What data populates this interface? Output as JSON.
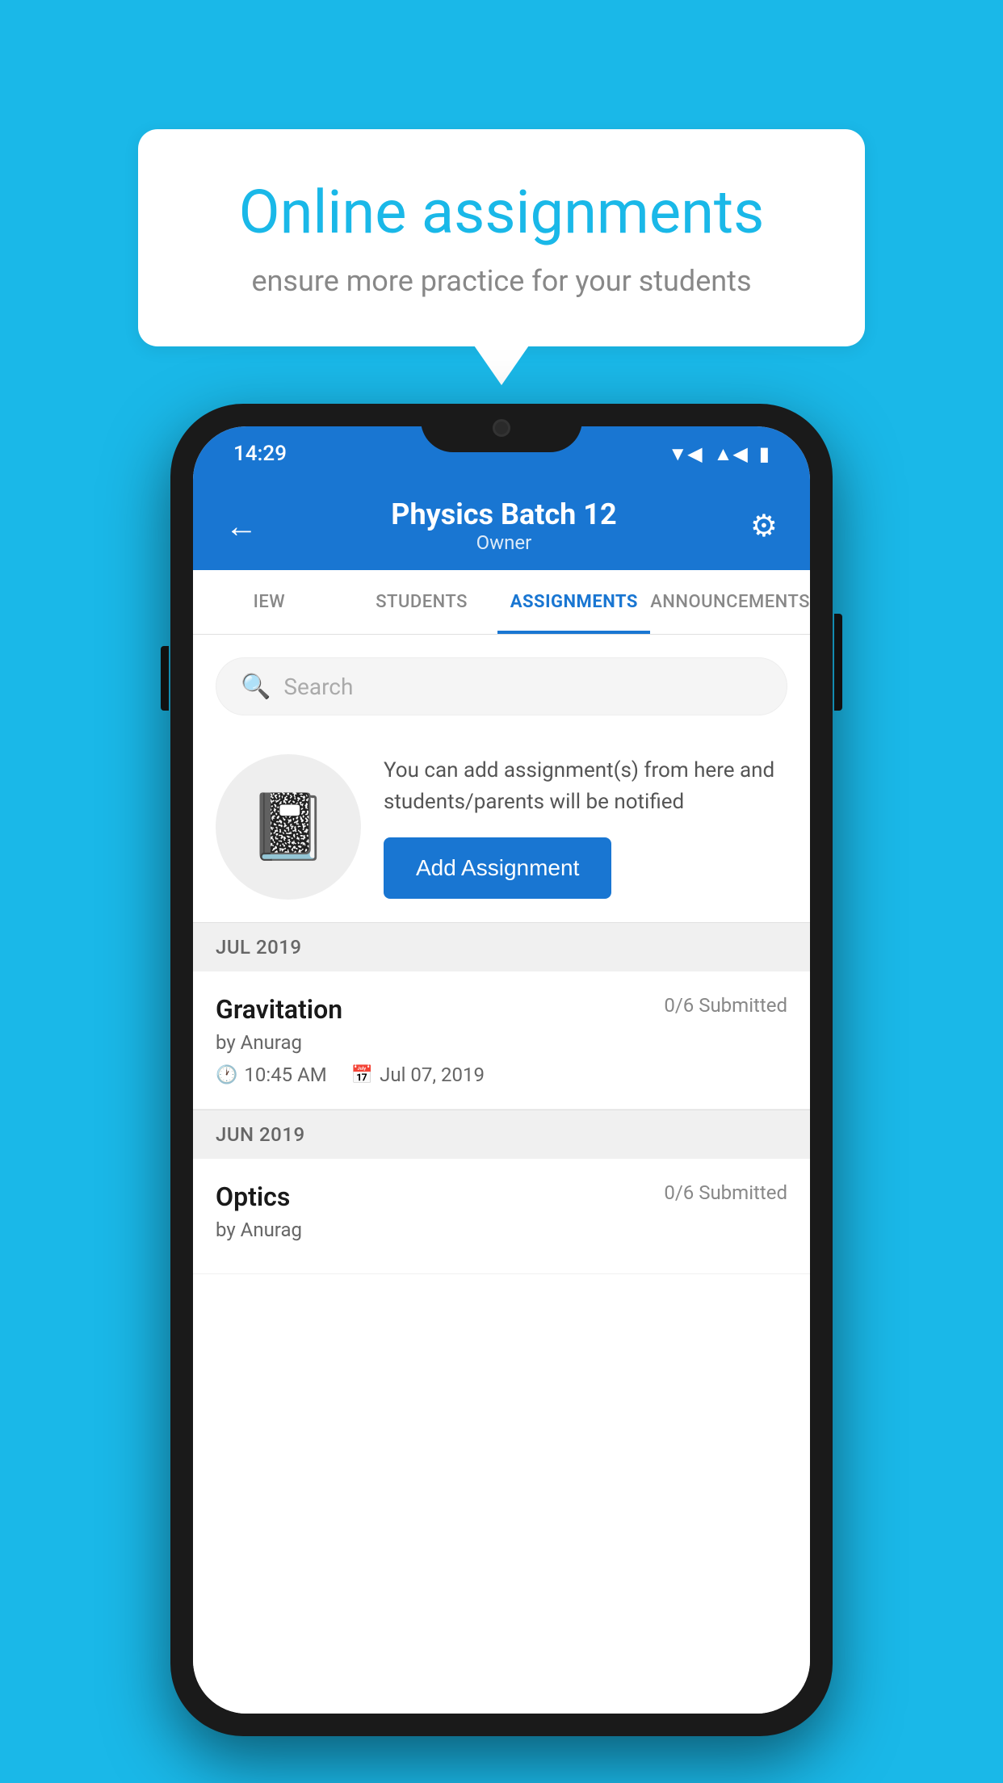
{
  "background_color": "#1ab8e8",
  "promo": {
    "title": "Online assignments",
    "subtitle": "ensure more practice for your students"
  },
  "status_bar": {
    "time": "14:29",
    "wifi": "▲",
    "signal": "▲",
    "battery": "▮"
  },
  "header": {
    "title": "Physics Batch 12",
    "subtitle": "Owner",
    "back_label": "←",
    "settings_label": "⚙"
  },
  "tabs": [
    {
      "label": "IEW",
      "active": false
    },
    {
      "label": "STUDENTS",
      "active": false
    },
    {
      "label": "ASSIGNMENTS",
      "active": true
    },
    {
      "label": "ANNOUNCEMENTS",
      "active": false
    }
  ],
  "search": {
    "placeholder": "Search"
  },
  "add_assignment": {
    "description": "You can add assignment(s) from here and students/parents will be notified",
    "button_label": "Add Assignment"
  },
  "sections": [
    {
      "month": "JUL 2019",
      "assignments": [
        {
          "name": "Gravitation",
          "submitted": "0/6 Submitted",
          "author": "by Anurag",
          "time": "10:45 AM",
          "date": "Jul 07, 2019"
        }
      ]
    },
    {
      "month": "JUN 2019",
      "assignments": [
        {
          "name": "Optics",
          "submitted": "0/6 Submitted",
          "author": "by Anurag",
          "time": "",
          "date": ""
        }
      ]
    }
  ]
}
